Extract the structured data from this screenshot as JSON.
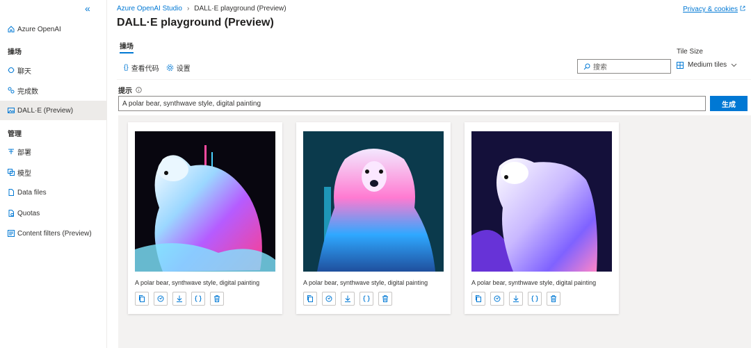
{
  "sidebar": {
    "items": [
      {
        "label": "Azure OpenAI",
        "icon": "home-icon"
      },
      {
        "header": "操场"
      },
      {
        "label": "聊天",
        "icon": "chat-icon"
      },
      {
        "label": "完成数",
        "icon": "completions-icon"
      },
      {
        "label": "DALL·E (Preview)",
        "icon": "image-icon",
        "active": true
      },
      {
        "header": "管理"
      },
      {
        "label": "部署",
        "icon": "deploy-icon"
      },
      {
        "label": "模型",
        "icon": "model-icon"
      },
      {
        "label": "Data files",
        "icon": "file-icon"
      },
      {
        "label": "Quotas",
        "icon": "quota-icon"
      },
      {
        "label": "Content filters (Preview)",
        "icon": "filter-icon"
      }
    ]
  },
  "header": {
    "breadcrumb_root": "Azure OpenAI Studio",
    "breadcrumb_current": "DALL·E playground (Preview)",
    "privacy": "Privacy & cookies",
    "title": "DALL·E playground (Preview)"
  },
  "tabs": {
    "active": "操场"
  },
  "toolbar": {
    "view_code": "查看代码",
    "settings": "设置",
    "search_placeholder": "搜索",
    "tile_size_label": "Tile Size",
    "tile_size_value": "Medium tiles"
  },
  "prompt": {
    "label": "提示",
    "value": "A polar bear, synthwave style, digital painting",
    "generate": "生成"
  },
  "results": [
    {
      "caption": "A polar bear, synthwave style, digital painting"
    },
    {
      "caption": "A polar bear, synthwave style, digital painting"
    },
    {
      "caption": "A polar bear, synthwave style, digital painting"
    }
  ],
  "colors": {
    "accent": "#0078d4",
    "gallery_bg": "#f3f2f1"
  }
}
